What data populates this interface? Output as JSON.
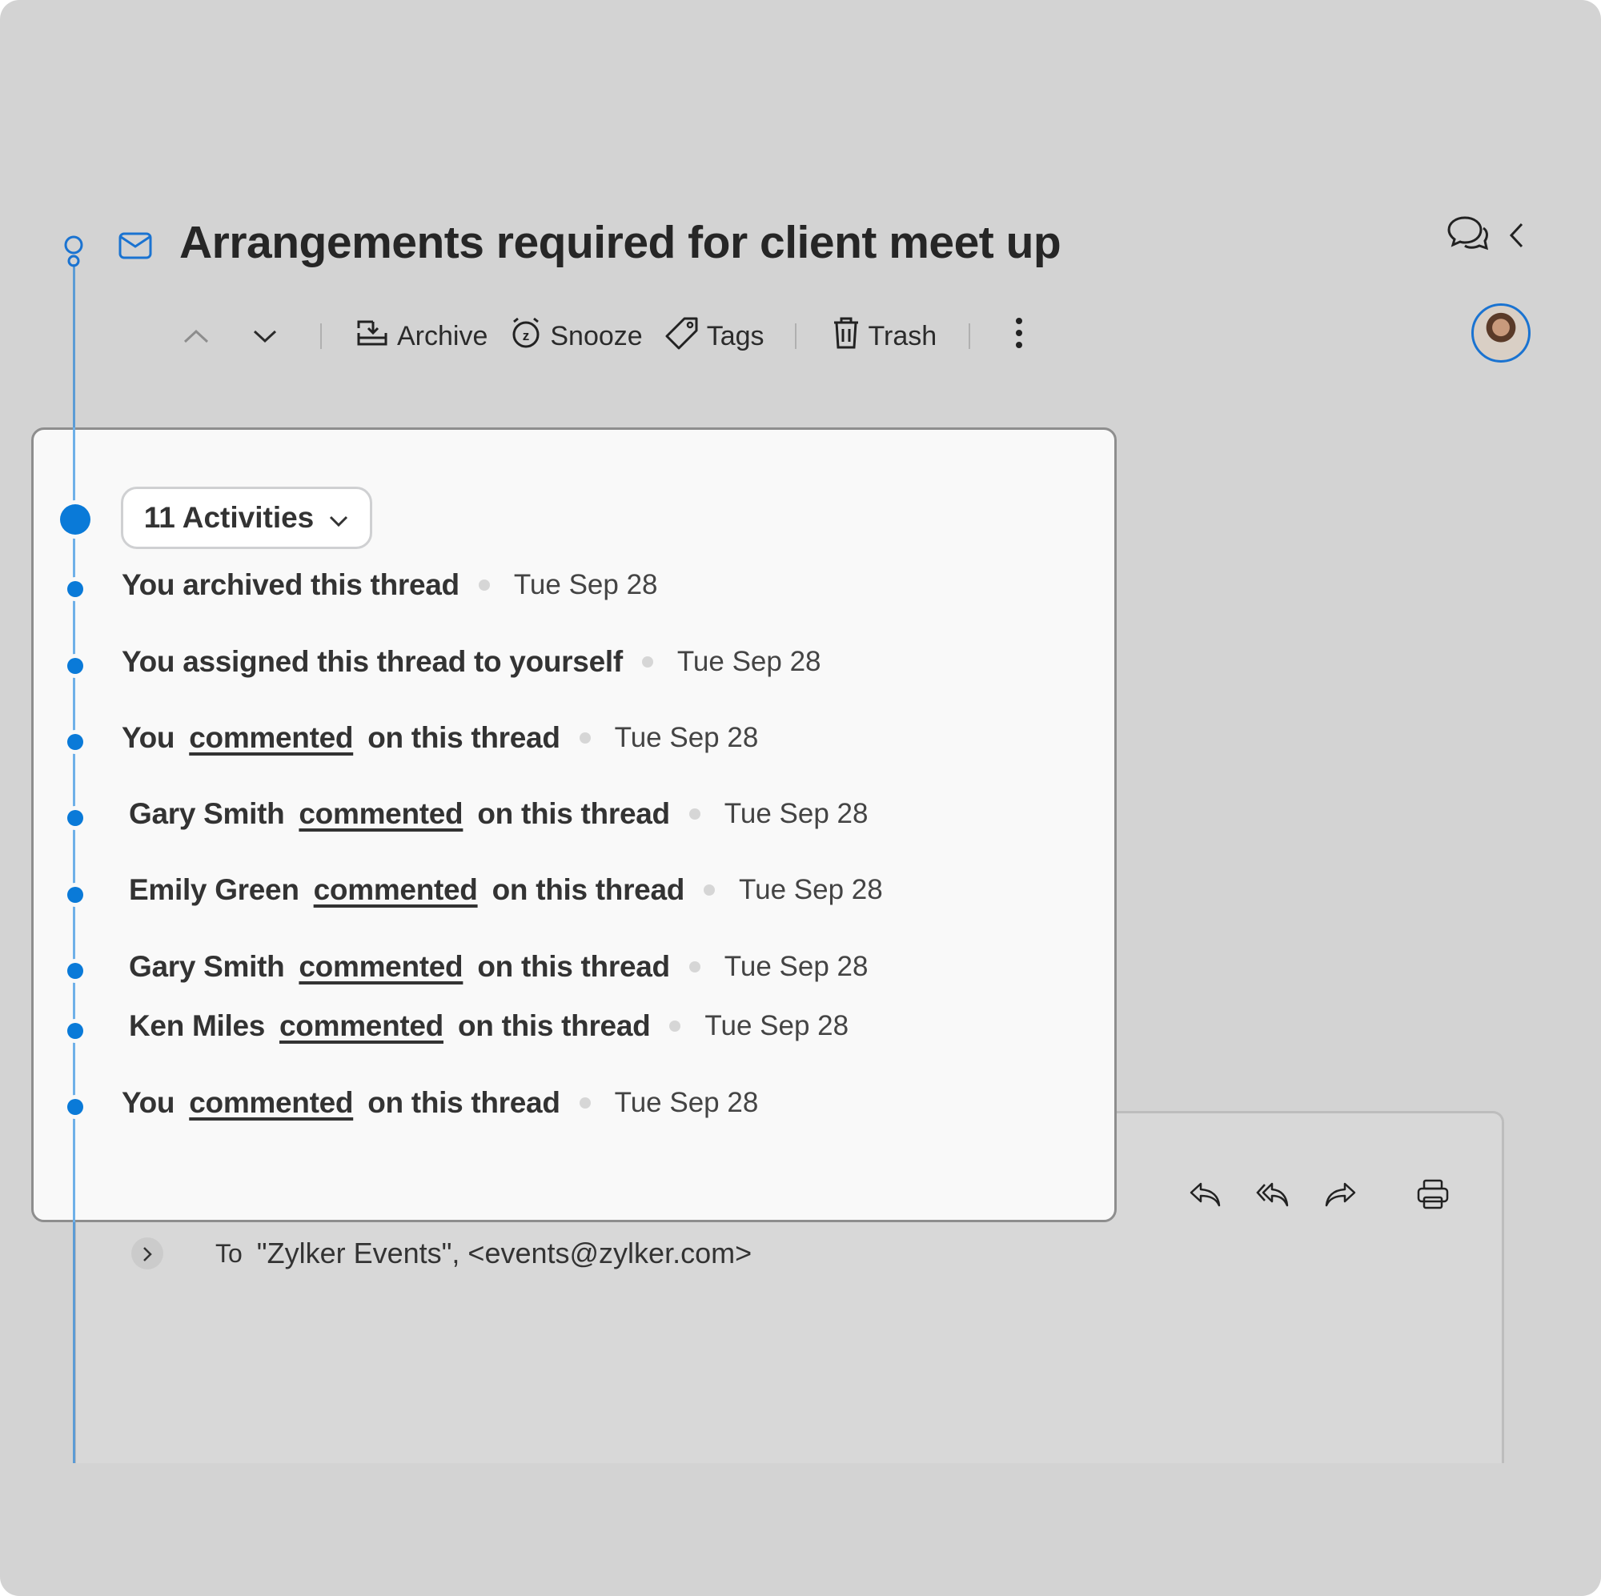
{
  "thread": {
    "title": "Arrangements required for client meet up"
  },
  "toolbar": {
    "prev_label": "Previous",
    "next_label": "Next",
    "archive_label": "Archive",
    "snooze_label": "Snooze",
    "tags_label": "Tags",
    "trash_label": "Trash"
  },
  "header_icons": [
    "comments-icon",
    "chevron-left-icon"
  ],
  "activities": {
    "button_label": "11 Activities",
    "items": [
      {
        "text": "You archived this thread",
        "date": "Tue Sep 28"
      },
      {
        "text": "You assigned this thread to yourself",
        "date": "Tue Sep 28"
      },
      {
        "actor": "You",
        "action": "commented",
        "suffix": "on this thread",
        "date": "Tue Sep 28"
      },
      {
        "actor": "Gary Smith",
        "action": "commented",
        "suffix": "on this thread",
        "date": "Tue Sep 28"
      },
      {
        "actor": "Emily Green",
        "action": "commented",
        "suffix": "on this thread",
        "date": "Tue Sep 28"
      },
      {
        "actor": "Gary Smith",
        "action": "commented",
        "suffix": "on this thread",
        "date": "Tue Sep 28"
      },
      {
        "actor": "Ken Miles",
        "action": "commented",
        "suffix": "on this thread",
        "date": "Tue Sep 28"
      },
      {
        "actor": "You",
        "action": "commented",
        "suffix": "on this thread",
        "date": "Tue Sep 28"
      }
    ]
  },
  "email": {
    "to_label": "To",
    "recipient": "\"Zylker Events\", <events@zylker.com>",
    "actions": [
      "reply-icon",
      "reply-all-icon",
      "forward-icon",
      "print-icon"
    ]
  },
  "colors": {
    "accent": "#0a7ad8",
    "timeline": "#5b9bd5",
    "background": "#d3d3d3",
    "panel": "#f9f9f9"
  }
}
